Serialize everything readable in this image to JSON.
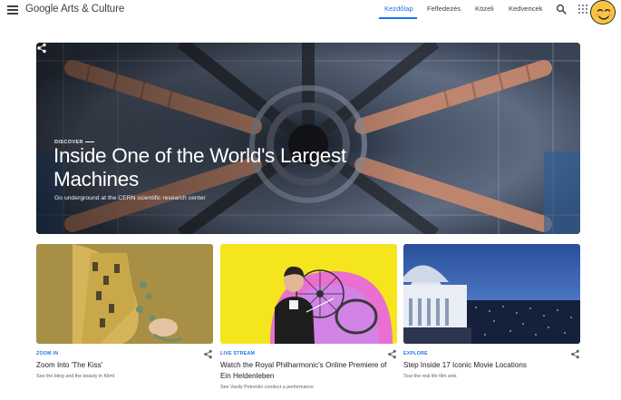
{
  "header": {
    "brand": "Google Arts & Culture",
    "icons": {
      "menu": "hamburger-menu-icon",
      "search": "search-icon",
      "apps": "apps-grid-icon"
    },
    "nav": [
      {
        "label": "Kezdőlap",
        "active": true
      },
      {
        "label": "Felfedezés",
        "active": false
      },
      {
        "label": "Közeli",
        "active": false
      },
      {
        "label": "Kedvencek",
        "active": false
      }
    ],
    "accent_color": "#1a73e8"
  },
  "hero": {
    "kicker": "DISCOVER",
    "title": "Inside One of the World's Largest Machines",
    "subtitle": "Go underground at the CERN scientific research center",
    "share_icon": "share-icon"
  },
  "cards": [
    {
      "kicker": "ZOOM IN",
      "title": "Zoom Into 'The Kiss'",
      "description": "See the bling and the beauty in Klimt"
    },
    {
      "kicker": "LIVE STREAM",
      "title": "Watch the Royal Philharmonic's Online Premiere of Ein Heldenleben",
      "description": "See Vasily Petrenko conduct a performance"
    },
    {
      "kicker": "EXPLORE",
      "title": "Step Inside 17 Iconic Movie Locations",
      "description": "Tour the real life film sets"
    }
  ]
}
